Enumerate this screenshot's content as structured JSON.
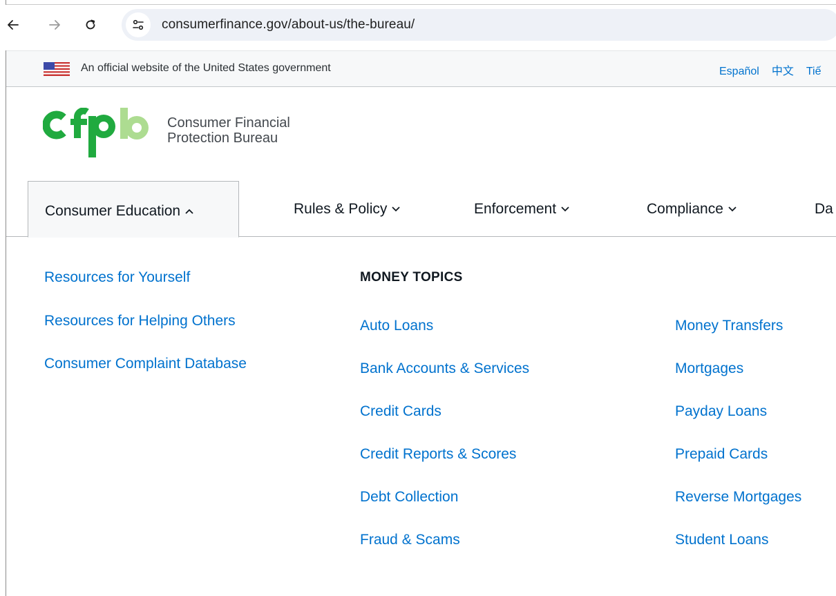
{
  "browser": {
    "url_domain": "consumerfinance.gov",
    "url_path": "/about-us/the-bureau/"
  },
  "gov_banner": {
    "text": "An official website of the United States government",
    "languages": [
      "Español",
      "中文",
      "Tiế"
    ]
  },
  "logo": {
    "wordmark": "cfpb",
    "line1": "Consumer Financial",
    "line2": "Protection Bureau",
    "colors": {
      "dark_green": "#20aa3f",
      "light_green": "#addc91"
    }
  },
  "nav": {
    "items": [
      {
        "label": "Consumer Education",
        "expanded": true
      },
      {
        "label": "Rules & Policy",
        "expanded": false
      },
      {
        "label": "Enforcement",
        "expanded": false
      },
      {
        "label": "Compliance",
        "expanded": false
      },
      {
        "label": "Da",
        "expanded": false
      }
    ]
  },
  "menu": {
    "left_links": [
      "Resources for Yourself",
      "Resources for Helping Others",
      "Consumer Complaint Database"
    ],
    "money_topics_heading": "MONEY TOPICS",
    "topics_col1": [
      "Auto Loans",
      "Bank Accounts & Services",
      "Credit Cards",
      "Credit Reports & Scores",
      "Debt Collection",
      "Fraud & Scams"
    ],
    "topics_col2": [
      "Money Transfers",
      "Mortgages",
      "Payday Loans",
      "Prepaid Cards",
      "Reverse Mortgages",
      "Student Loans"
    ]
  },
  "colors": {
    "link": "#0072ce",
    "banner_bg": "#f7f8f9",
    "address_bar_bg": "#eef1f7"
  }
}
